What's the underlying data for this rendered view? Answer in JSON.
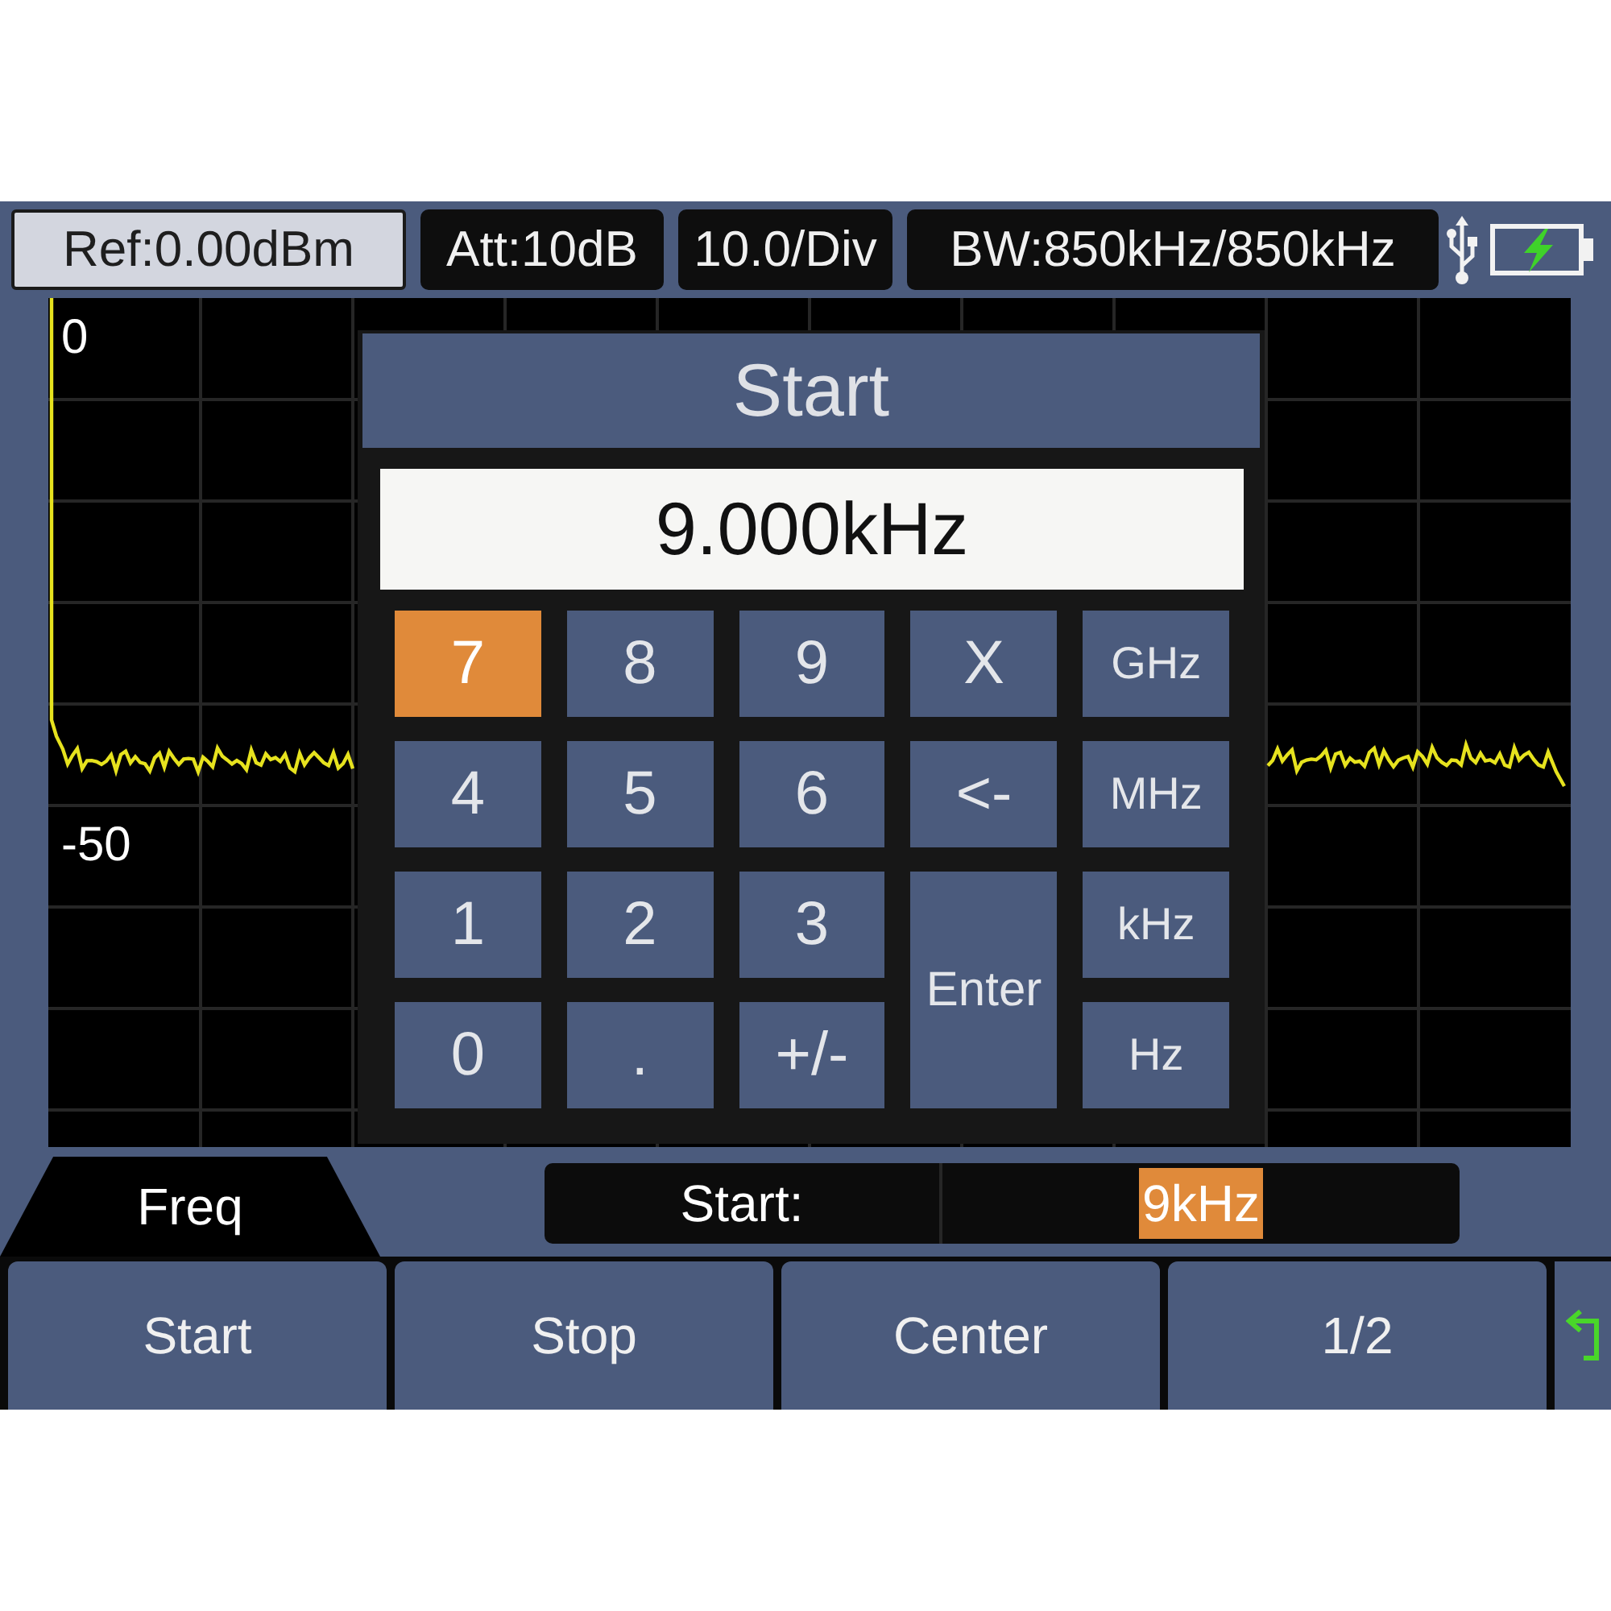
{
  "status_bar": {
    "readouts": [
      {
        "text": "Ref:0.00dBm",
        "selected": true
      },
      {
        "text": "Att:10dB",
        "selected": false
      },
      {
        "text": "10.0/Div",
        "selected": false
      },
      {
        "text": "BW:850kHz/850kHz",
        "selected": false
      }
    ],
    "battery": {
      "charging": true
    }
  },
  "plot": {
    "scale_labels": [
      "0",
      "-50"
    ]
  },
  "dialog": {
    "title": "Start",
    "value": "9.000kHz",
    "keys": [
      {
        "label": "7",
        "kind": "digit",
        "selected": true
      },
      {
        "label": "8",
        "kind": "digit",
        "selected": false
      },
      {
        "label": "9",
        "kind": "digit",
        "selected": false
      },
      {
        "label": "X",
        "kind": "action",
        "selected": false
      },
      {
        "label": "GHz",
        "kind": "unit",
        "selected": false
      },
      {
        "label": "4",
        "kind": "digit",
        "selected": false
      },
      {
        "label": "5",
        "kind": "digit",
        "selected": false
      },
      {
        "label": "6",
        "kind": "digit",
        "selected": false
      },
      {
        "label": "<-",
        "kind": "action",
        "selected": false
      },
      {
        "label": "MHz",
        "kind": "unit",
        "selected": false
      },
      {
        "label": "1",
        "kind": "digit",
        "selected": false
      },
      {
        "label": "2",
        "kind": "digit",
        "selected": false
      },
      {
        "label": "3",
        "kind": "digit",
        "selected": false
      },
      {
        "label": "Enter",
        "kind": "enter",
        "selected": false
      },
      {
        "label": "kHz",
        "kind": "unit",
        "selected": false
      },
      {
        "label": "0",
        "kind": "digit",
        "selected": false
      },
      {
        "label": ".",
        "kind": "digit",
        "selected": false
      },
      {
        "label": "+/-",
        "kind": "digit",
        "selected": false
      },
      {
        "label": "Hz",
        "kind": "unit",
        "selected": false
      }
    ]
  },
  "menu": {
    "title": "Freq"
  },
  "parameter_bar": {
    "label": "Start:",
    "value": "9kHz"
  },
  "softkeys": [
    {
      "label": "Start"
    },
    {
      "label": "Stop"
    },
    {
      "label": "Center"
    },
    {
      "label": "1/2"
    }
  ]
}
